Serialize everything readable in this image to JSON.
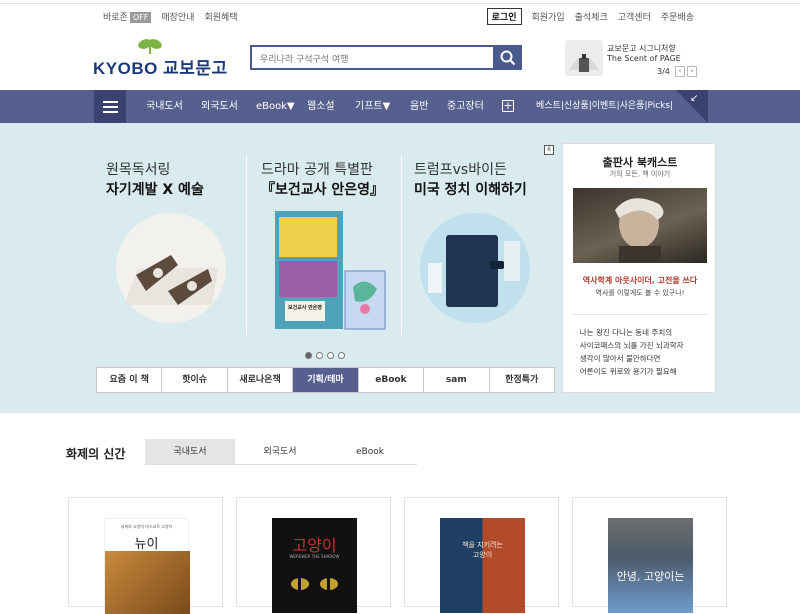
{
  "util_left": {
    "baro": "바로존",
    "off": "OFF",
    "store": "매장안내",
    "benefit": "회원혜택"
  },
  "util_right": {
    "login": "로그인",
    "join": "회원가입",
    "attend": "출석체크",
    "cs": "고객센터",
    "order": "주문배송"
  },
  "logo": {
    "text": "KYOBO 교보문고",
    "color": "#1c3a7a",
    "leaf_color": "#7cb342"
  },
  "search": {
    "placeholder": "우리나라 구석구석 여행"
  },
  "promo": {
    "line1": "교보문고 시그니처향",
    "line2": "The Scent of PAGE",
    "page": "3/4",
    "prev": "‹",
    "next": "›"
  },
  "nav": {
    "items": [
      "국내도서",
      "외국도서",
      "eBook▼",
      "웹소설",
      "기프트▼",
      "음반",
      "중고장터"
    ],
    "plus": "+",
    "extra": "베스트|신상품|이벤트|사은품|Picks|",
    "accent": "#575f8f"
  },
  "banner": {
    "panels": [
      {
        "title": "원목독서링",
        "sub": "자기계발 X 예술"
      },
      {
        "title": "드라마 공개 특별판",
        "sub": "『보건교사 안은영』"
      },
      {
        "title": "트럼프vs바이든",
        "sub": "미국 정치 이해하기"
      }
    ],
    "pause": "II",
    "book_label": "보건교사 안은영"
  },
  "banner_tabs": [
    "요즘 이 책",
    "핫이슈",
    "새로나온책",
    "기획/테마",
    "eBook",
    "sam",
    "한정특가"
  ],
  "side": {
    "title": "출판사 북캐스트",
    "sub": "거의 모든, 책 이야기",
    "headline": "역사학계 아웃사이더, 고전을 쓰다",
    "desc": "역사를 이렇게도 볼 수 있구나!",
    "list": [
      "나는 왕진 다니는 동네 주치의",
      "사이코패스의 뇌를 가진 뇌과학자",
      "생각이 많아서 불안하다면",
      "어른이도 위로와 용기가 필요해"
    ]
  },
  "section": {
    "title": "화제의 신간",
    "tabs": [
      "국내도서",
      "외국도서",
      "eBook"
    ]
  },
  "books": [
    {
      "small": "세계의 고양이 마스코트 고양이",
      "title": "뉴이"
    },
    {
      "title": "고양이",
      "small": "WEREWER THE SHADOW"
    },
    {
      "title": "책을 지키려는 고양이",
      "small": ""
    },
    {
      "title": "안녕, 고양이는",
      "small": ""
    }
  ]
}
